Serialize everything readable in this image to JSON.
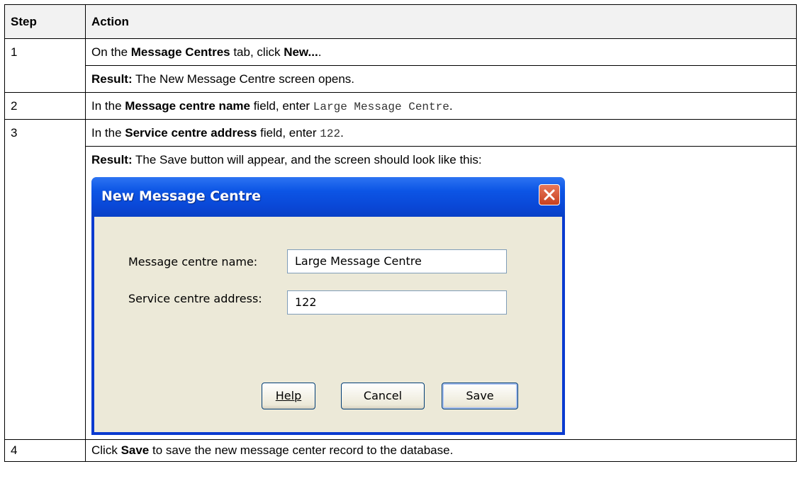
{
  "table": {
    "header": {
      "step": "Step",
      "action": "Action"
    },
    "rows": [
      {
        "step": "1",
        "line1": {
          "a": "On the ",
          "b1": "Message Centres",
          "c": " tab, click ",
          "b2": "New...",
          "d": "."
        },
        "line2": {
          "b": "Result:",
          "a": " The New Message Centre screen opens."
        }
      },
      {
        "step": "2",
        "line1": {
          "a": "In the ",
          "b": "Message centre name",
          "c": " field, enter ",
          "code": "Large Message Centre",
          "d": "."
        }
      },
      {
        "step": "3",
        "line1": {
          "a": "In the ",
          "b": "Service centre address",
          "c": " field, enter ",
          "code": "122",
          "d": "."
        },
        "line2": {
          "b": "Result:",
          "a": " The Save button will appear, and the screen should look like this:"
        }
      },
      {
        "step": "4",
        "line1": {
          "a": "Click ",
          "b": "Save",
          "c": " to save the new message center record to the database."
        }
      }
    ]
  },
  "dialog": {
    "title": "New Message Centre",
    "name_label": "Message centre name:",
    "name_value": "Large Message Centre",
    "address_label": "Service centre address:",
    "address_value": "122",
    "help_label": "Help",
    "cancel_label": "Cancel",
    "save_label": "Save",
    "close_icon": "close-icon"
  }
}
